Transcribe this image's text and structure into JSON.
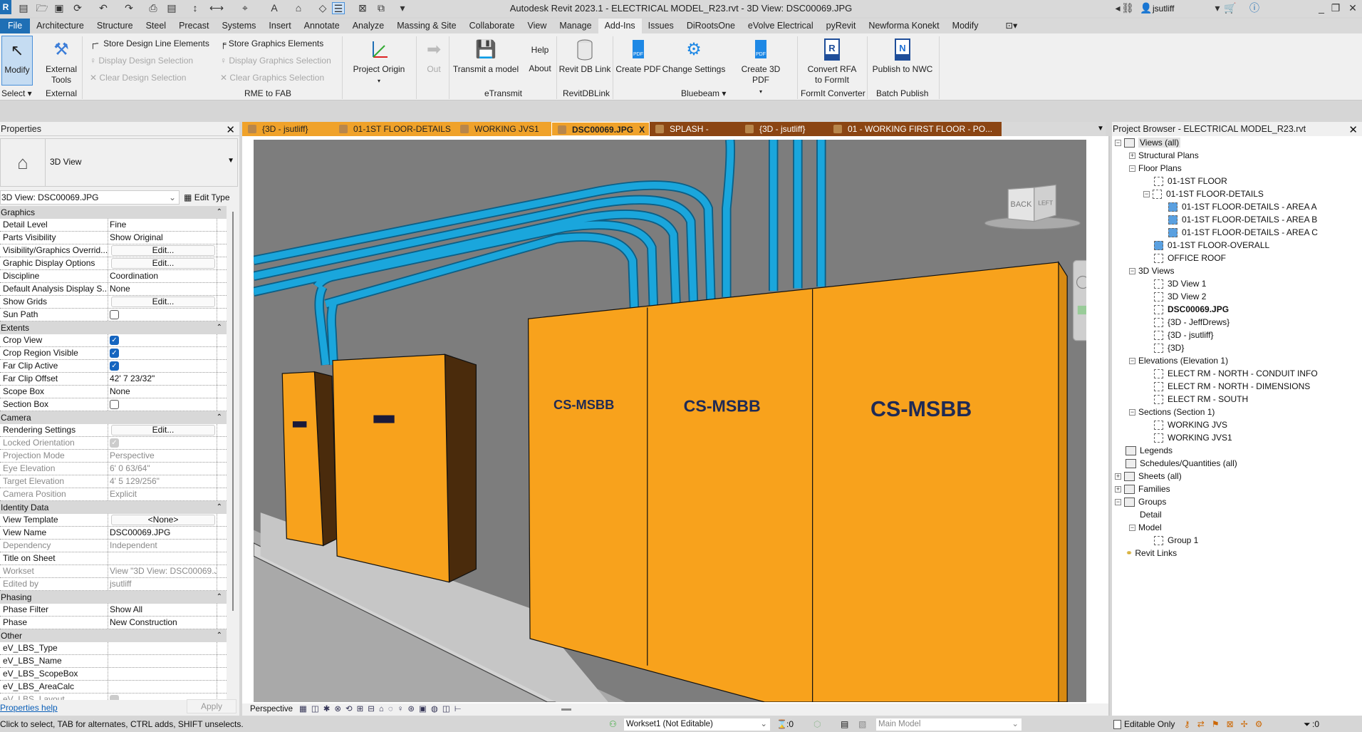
{
  "app": {
    "title": "Autodesk Revit 2023.1 - ELECTRICAL MODEL_R23.rvt - 3D View: DSC00069.JPG",
    "user": "jsutliff"
  },
  "ribbon_tabs": [
    "File",
    "Architecture",
    "Structure",
    "Steel",
    "Precast",
    "Systems",
    "Insert",
    "Annotate",
    "Analyze",
    "Massing & Site",
    "Collaborate",
    "View",
    "Manage",
    "Add-Ins",
    "Issues",
    "DiRootsOne",
    "eVolve Electrical",
    "pyRevit",
    "Newforma Konekt",
    "Modify"
  ],
  "active_ribbon_tab": "Add-Ins",
  "ribbon": {
    "modify": "Modify",
    "external_tools": "External Tools",
    "store_design": "Store Design Line Elements",
    "display_design": "Display Design Selection",
    "clear_design": "Clear Design Selection",
    "store_graphics": "Store Graphics Elements",
    "display_graphics": "Display Graphics Selection",
    "clear_graphics": "Clear Graphics Selection",
    "project_origin": "Project Origin",
    "out": "Out",
    "transmit": "Transmit a model",
    "help": "Help",
    "about": "About",
    "revit_db_link": "Revit DB Link",
    "create_pdf": "Create PDF",
    "change_settings": "Change Settings",
    "create_3d_pdf": "Create 3D PDF",
    "convert_rfa": "Convert RFA to FormIt",
    "publish_nwc": "Publish to NWC",
    "panels": {
      "select": "Select ▾",
      "external": "External",
      "rme_to_fab": "RME to FAB",
      "etransmit": "eTransmit",
      "revitdblink": "RevitDBLink",
      "bluebeam": "Bluebeam ▾",
      "formit": "FormIt Converter",
      "batch": "Batch Publish"
    }
  },
  "properties": {
    "title": "Properties",
    "type_name": "3D View",
    "instance_selector": "3D View: DSC00069.JPG",
    "edit_type": "Edit Type",
    "help_link": "Properties help",
    "apply": "Apply",
    "sections": [
      {
        "name": "Graphics",
        "rows": [
          {
            "label": "Detail Level",
            "value": "Fine"
          },
          {
            "label": "Parts Visibility",
            "value": "Show Original"
          },
          {
            "label": "Visibility/Graphics Overrid...",
            "value": "Edit...",
            "type": "button"
          },
          {
            "label": "Graphic Display Options",
            "value": "Edit...",
            "type": "button"
          },
          {
            "label": "Discipline",
            "value": "Coordination"
          },
          {
            "label": "Default Analysis Display S...",
            "value": "None"
          },
          {
            "label": "Show Grids",
            "value": "Edit...",
            "type": "button"
          },
          {
            "label": "Sun Path",
            "type": "check",
            "checked": false
          }
        ]
      },
      {
        "name": "Extents",
        "rows": [
          {
            "label": "Crop View",
            "type": "check",
            "checked": true
          },
          {
            "label": "Crop Region Visible",
            "type": "check",
            "checked": true
          },
          {
            "label": "Far Clip Active",
            "type": "check",
            "checked": true
          },
          {
            "label": "Far Clip Offset",
            "value": "42'  7 23/32\""
          },
          {
            "label": "Scope Box",
            "value": "None"
          },
          {
            "label": "Section Box",
            "type": "check",
            "checked": false
          }
        ]
      },
      {
        "name": "Camera",
        "rows": [
          {
            "label": "Rendering Settings",
            "value": "Edit...",
            "type": "button"
          },
          {
            "label": "Locked Orientation",
            "type": "check",
            "checked": true,
            "disabled": true
          },
          {
            "label": "Projection Mode",
            "value": "Perspective",
            "disabled": true
          },
          {
            "label": "Eye Elevation",
            "value": "6'  0 63/64\"",
            "disabled": true
          },
          {
            "label": "Target Elevation",
            "value": "4'  5 129/256\"",
            "disabled": true
          },
          {
            "label": "Camera Position",
            "value": "Explicit",
            "disabled": true
          }
        ]
      },
      {
        "name": "Identity Data",
        "rows": [
          {
            "label": "View Template",
            "value": "<None>",
            "type": "button"
          },
          {
            "label": "View Name",
            "value": "DSC00069.JPG"
          },
          {
            "label": "Dependency",
            "value": "Independent",
            "disabled": true
          },
          {
            "label": "Title on Sheet",
            "value": ""
          },
          {
            "label": "Workset",
            "value": "View \"3D View: DSC00069.J...",
            "disabled": true
          },
          {
            "label": "Edited by",
            "value": "jsutliff",
            "disabled": true
          }
        ]
      },
      {
        "name": "Phasing",
        "rows": [
          {
            "label": "Phase Filter",
            "value": "Show All"
          },
          {
            "label": "Phase",
            "value": "New Construction"
          }
        ]
      },
      {
        "name": "Other",
        "rows": [
          {
            "label": "eV_LBS_Type",
            "value": ""
          },
          {
            "label": "eV_LBS_Name",
            "value": ""
          },
          {
            "label": "eV_LBS_ScopeBox",
            "value": ""
          },
          {
            "label": "eV_LBS_AreaCalc",
            "value": ""
          },
          {
            "label": "eV_LBS_Layout",
            "type": "check",
            "checked": false,
            "disabled": true
          }
        ]
      }
    ]
  },
  "doc_tabs": [
    {
      "label": "{3D - jsutliff}",
      "style": "or"
    },
    {
      "label": "01-1ST FLOOR-DETAILS",
      "style": "or"
    },
    {
      "label": "WORKING JVS1",
      "style": "or"
    },
    {
      "label": "DSC00069.JPG",
      "style": "act",
      "close": "X"
    },
    {
      "label": "SPLASH -",
      "style": "br"
    },
    {
      "label": "{3D - jsutliff}",
      "style": "br"
    },
    {
      "label": "01 - WORKING FIRST FLOOR - PO...",
      "style": "br"
    }
  ],
  "viewport": {
    "panel_labels": [
      "CS-MSBB",
      "CS-MSBB",
      "CS-MSBB"
    ],
    "navcube": {
      "back": "BACK",
      "left": "LEFT"
    },
    "colors": {
      "panel": "#f8a21c",
      "panel_side": "#4a2b0c",
      "conduit": "#1aa6dc",
      "background": "#7d7d7d"
    }
  },
  "view_control_bar": {
    "mode": "Perspective"
  },
  "project_browser": {
    "title": "Project Browser - ELECTRICAL MODEL_R23.rvt",
    "nodes": [
      {
        "label": "Views (all)",
        "level": 0,
        "exp": "−",
        "icon": "views",
        "selected": true
      },
      {
        "label": "Structural Plans",
        "level": 1,
        "exp": "+"
      },
      {
        "label": "Floor Plans",
        "level": 1,
        "exp": "−"
      },
      {
        "label": "01-1ST FLOOR",
        "level": 2,
        "icon": "view"
      },
      {
        "label": "01-1ST FLOOR-DETAILS",
        "level": 2,
        "icon": "view",
        "exp": "−"
      },
      {
        "label": "01-1ST FLOOR-DETAILS - AREA A",
        "level": 3,
        "icon": "view-blue"
      },
      {
        "label": "01-1ST FLOOR-DETAILS - AREA B",
        "level": 3,
        "icon": "view-blue"
      },
      {
        "label": "01-1ST FLOOR-DETAILS - AREA C",
        "level": 3,
        "icon": "view-blue"
      },
      {
        "label": "01-1ST FLOOR-OVERALL",
        "level": 2,
        "icon": "view-blue"
      },
      {
        "label": "OFFICE ROOF",
        "level": 2,
        "icon": "view"
      },
      {
        "label": "3D Views",
        "level": 1,
        "exp": "−"
      },
      {
        "label": "3D View 1",
        "level": 2,
        "icon": "view"
      },
      {
        "label": "3D View 2",
        "level": 2,
        "icon": "view"
      },
      {
        "label": "DSC00069.JPG",
        "level": 2,
        "icon": "view",
        "bold": true
      },
      {
        "label": "{3D - JeffDrews}",
        "level": 2,
        "icon": "view"
      },
      {
        "label": "{3D - jsutliff}",
        "level": 2,
        "icon": "view"
      },
      {
        "label": "{3D}",
        "level": 2,
        "icon": "view"
      },
      {
        "label": "Elevations (Elevation 1)",
        "level": 1,
        "exp": "−"
      },
      {
        "label": "ELECT RM - NORTH - CONDUIT INFO",
        "level": 2,
        "icon": "view"
      },
      {
        "label": "ELECT RM - NORTH - DIMENSIONS",
        "level": 2,
        "icon": "view"
      },
      {
        "label": "ELECT RM - SOUTH",
        "level": 2,
        "icon": "view"
      },
      {
        "label": "Sections (Section 1)",
        "level": 1,
        "exp": "−"
      },
      {
        "label": "WORKING JVS",
        "level": 2,
        "icon": "view"
      },
      {
        "label": "WORKING JVS1",
        "level": 2,
        "icon": "view"
      },
      {
        "label": "Legends",
        "level": 0,
        "icon": "group"
      },
      {
        "label": "Schedules/Quantities (all)",
        "level": 0,
        "icon": "group"
      },
      {
        "label": "Sheets (all)",
        "level": 0,
        "icon": "group",
        "exp": "+"
      },
      {
        "label": "Families",
        "level": 0,
        "icon": "group",
        "exp": "+"
      },
      {
        "label": "Groups",
        "level": 0,
        "icon": "group",
        "exp": "−"
      },
      {
        "label": "Detail",
        "level": 1
      },
      {
        "label": "Model",
        "level": 1,
        "exp": "−"
      },
      {
        "label": "Group 1",
        "level": 2,
        "icon": "view"
      },
      {
        "label": "Revit Links",
        "level": 0,
        "icon": "link"
      }
    ]
  },
  "status_bar": {
    "hint": "Click to select, TAB for alternates, CTRL adds, SHIFT unselects.",
    "workset": "Workset1 (Not Editable)",
    "count1": ":0",
    "design_option": "Main Model",
    "editable_only": "Editable Only",
    "filter_count": ":0"
  }
}
